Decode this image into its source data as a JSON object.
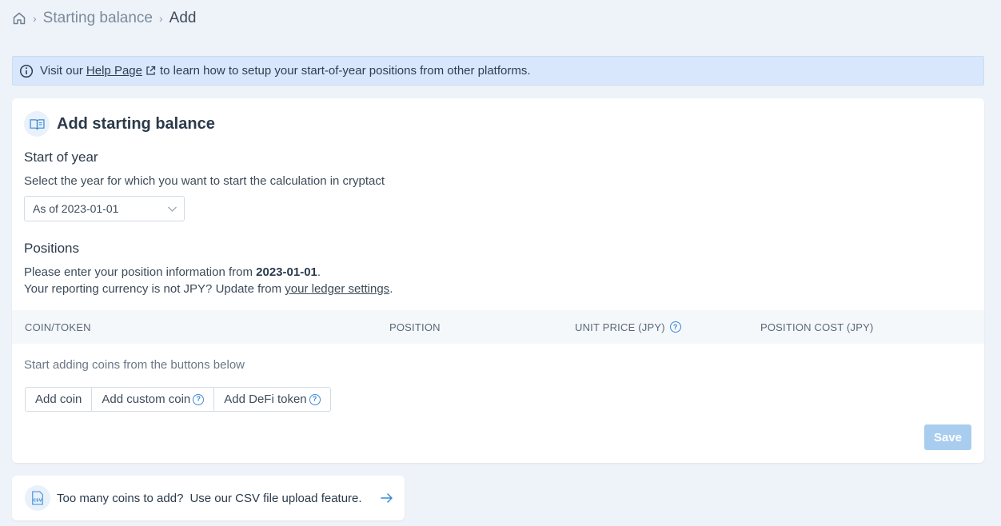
{
  "breadcrumb": {
    "parent": "Starting balance",
    "current": "Add"
  },
  "banner": {
    "prefix": "Visit our",
    "link": "Help Page",
    "suffix": "to learn how to setup your start-of-year positions from other platforms."
  },
  "card": {
    "title": "Add starting balance",
    "start_of_year": {
      "title": "Start of year",
      "description": "Select the year for which you want to start the calculation in cryptact",
      "selected": "As of 2023-01-01"
    },
    "positions": {
      "title": "Positions",
      "line1_prefix": "Please enter your position information from",
      "line1_date": "2023-01-01",
      "line1_suffix": ".",
      "line2_prefix": "Your reporting currency is not JPY? Update from",
      "line2_link": "your ledger settings",
      "line2_suffix": "."
    },
    "table": {
      "columns": [
        "COIN/TOKEN",
        "POSITION",
        "UNIT PRICE (JPY)",
        "POSITION COST (JPY)"
      ],
      "empty_message": "Start adding coins from the buttons below"
    },
    "buttons": {
      "add_coin": "Add coin",
      "add_custom_coin": "Add custom coin",
      "add_defi_token": "Add DeFi token",
      "save": "Save"
    }
  },
  "csv": {
    "icon_label": "CSV",
    "question": "Too many coins to add?",
    "text": "Use our CSV file upload feature."
  },
  "colors": {
    "accent": "#3a8ad8",
    "background": "#eef3f9",
    "banner": "#d8e7fb",
    "save_disabled": "#a9cdee"
  }
}
